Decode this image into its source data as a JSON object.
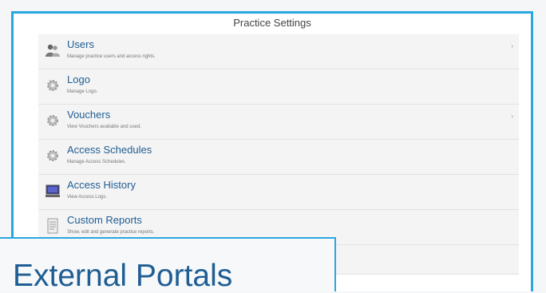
{
  "header": {
    "title": "Practice Settings"
  },
  "items": [
    {
      "label": "Users",
      "desc": "Manage practice users and access rights.",
      "icon": "users-icon",
      "chevron": true
    },
    {
      "label": "Logo",
      "desc": "Manage Logo.",
      "icon": "gear-icon",
      "chevron": false
    },
    {
      "label": "Vouchers",
      "desc": "View Vouchers available and used.",
      "icon": "gear-icon",
      "chevron": true
    },
    {
      "label": "Access Schedules",
      "desc": "Manage Access Schedules.",
      "icon": "gear-icon",
      "chevron": false
    },
    {
      "label": "Access History",
      "desc": "View Access Logs.",
      "icon": "computer-icon",
      "chevron": false
    },
    {
      "label": "Custom Reports",
      "desc": "Show, edit and generate practice reports.",
      "icon": "report-icon",
      "chevron": false
    }
  ],
  "chevron_glyph": "›",
  "overlay": {
    "caption": "External Portals"
  },
  "colors": {
    "accent": "#29a7df",
    "link": "#1f5d93"
  }
}
